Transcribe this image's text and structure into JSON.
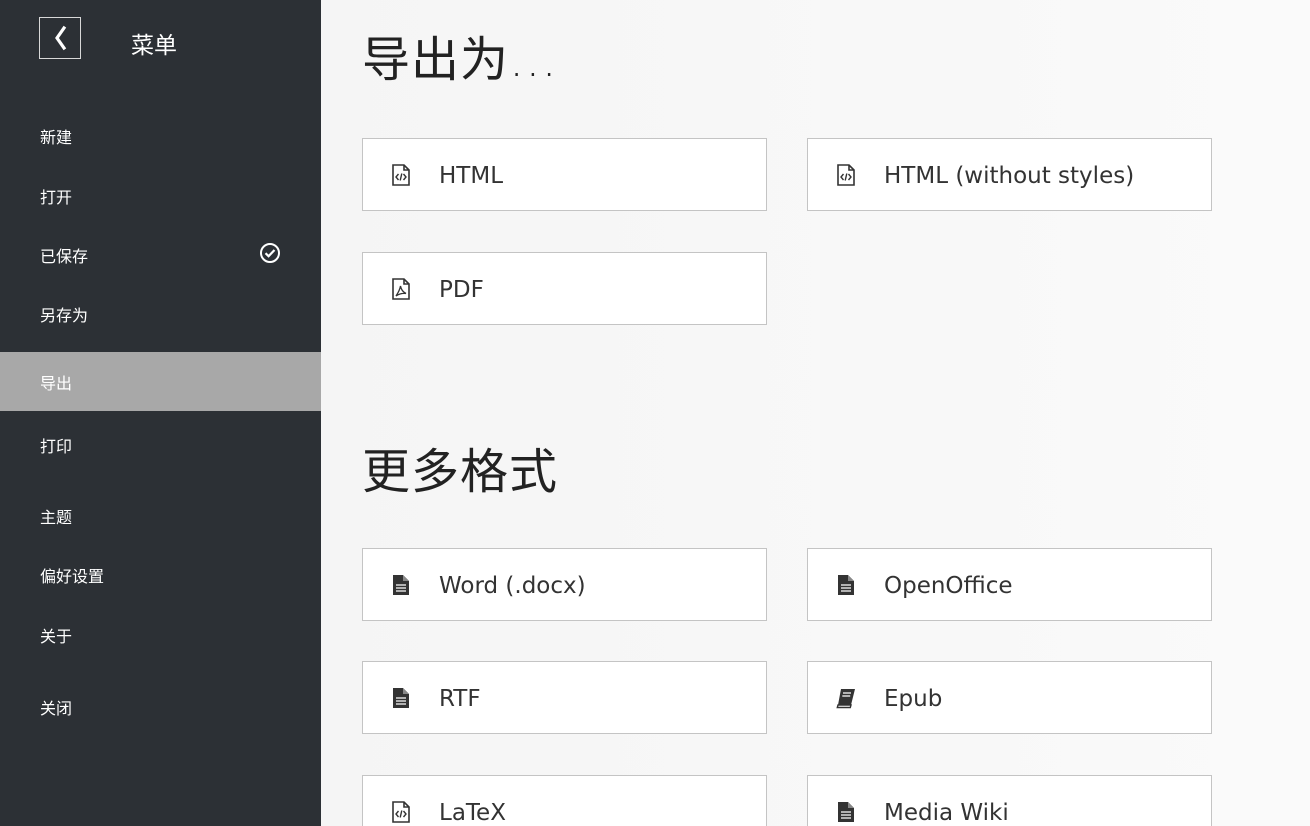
{
  "sidebar": {
    "title": "菜单",
    "back_icon": "chevron-left-icon",
    "items": [
      {
        "label": "新建"
      },
      {
        "label": "打开"
      },
      {
        "label": "已保存",
        "status_icon": "check-circle-icon"
      },
      {
        "label": "另存为"
      },
      {
        "label": "导出",
        "active": true
      },
      {
        "label": "打印"
      },
      {
        "label": "主题"
      },
      {
        "label": "偏好设置"
      },
      {
        "label": "关于"
      },
      {
        "label": "关闭"
      }
    ]
  },
  "main": {
    "export_heading": "导出为...",
    "export_options": [
      {
        "label": "HTML",
        "icon": "file-code-icon"
      },
      {
        "label": "HTML (without styles)",
        "icon": "file-code-icon"
      },
      {
        "label": "PDF",
        "icon": "file-pdf-icon"
      }
    ],
    "more_heading": "更多格式",
    "more_options": [
      {
        "label": "Word (.docx)",
        "icon": "file-text-icon"
      },
      {
        "label": "OpenOffice",
        "icon": "file-text-icon"
      },
      {
        "label": "RTF",
        "icon": "file-text-icon"
      },
      {
        "label": "Epub",
        "icon": "book-icon"
      },
      {
        "label": "LaTeX",
        "icon": "file-code-icon"
      },
      {
        "label": "Media Wiki",
        "icon": "file-text-icon"
      }
    ]
  },
  "colors": {
    "sidebar_bg": "#2c3035",
    "active_item_bg": "#a8a8a8",
    "button_border": "#c4c4c4"
  }
}
